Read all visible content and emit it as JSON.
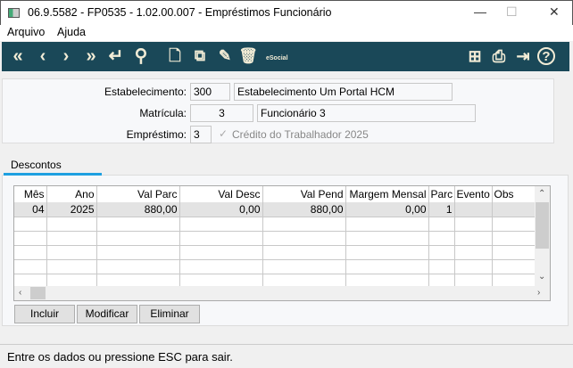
{
  "window": {
    "title": "06.9.5582 - FP0535 - 1.02.00.007 - Empréstimos Funcionário",
    "minimize": "—",
    "maximize": "☐",
    "close": "✕"
  },
  "menu": [
    "Arquivo",
    "Ajuda"
  ],
  "toolbar": {
    "left": [
      {
        "icon": "first-icon",
        "glyph": "«"
      },
      {
        "icon": "previous-icon",
        "glyph": "‹"
      },
      {
        "icon": "next-icon",
        "glyph": "›"
      },
      {
        "icon": "last-icon",
        "glyph": "»"
      },
      {
        "icon": "return-icon",
        "glyph": "↵"
      },
      {
        "icon": "search-icon",
        "glyph": "⚲"
      },
      {
        "icon": "new-document-icon",
        "glyph": "🗋"
      },
      {
        "icon": "copy-icon",
        "glyph": "⧉"
      },
      {
        "icon": "edit-icon",
        "glyph": "✎"
      },
      {
        "icon": "delete-icon",
        "glyph": "🗑"
      }
    ],
    "esocial": "eSocial",
    "right": [
      {
        "icon": "tree-icon",
        "glyph": "⊞"
      },
      {
        "icon": "print-icon",
        "glyph": "⎙"
      },
      {
        "icon": "exit-icon",
        "glyph": "⇥"
      },
      {
        "icon": "help-icon",
        "glyph": "?"
      }
    ],
    "bg": "#1a4858"
  },
  "form": {
    "estabelecimento_label": "Estabelecimento:",
    "estabelecimento_code": "300",
    "estabelecimento_name": "Estabelecimento Um Portal HCM",
    "matricula_label": "Matrícula:",
    "matricula_code": "3",
    "matricula_name": "Funcionário 3",
    "emprestimo_label": "Empréstimo:",
    "emprestimo_code": "3",
    "credito_label": "Crédito do Trabalhador 2025",
    "credito_checked": true
  },
  "tabs": [
    {
      "label": "Descontos",
      "active": true
    }
  ],
  "grid": {
    "columns": [
      "Mês",
      "Ano",
      "Val Parc",
      "Val Desc",
      "Val Pend",
      "Margem Mensal",
      "Parc",
      "Evento",
      "Obs"
    ],
    "rows": [
      [
        "04",
        "2025",
        "880,00",
        "0,00",
        "880,00",
        "0,00",
        "1",
        "",
        ""
      ]
    ]
  },
  "buttons": {
    "incluir": "Incluir",
    "modificar": "Modificar",
    "eliminar": "Eliminar"
  },
  "status": "Entre os dados ou pressione ESC para sair."
}
